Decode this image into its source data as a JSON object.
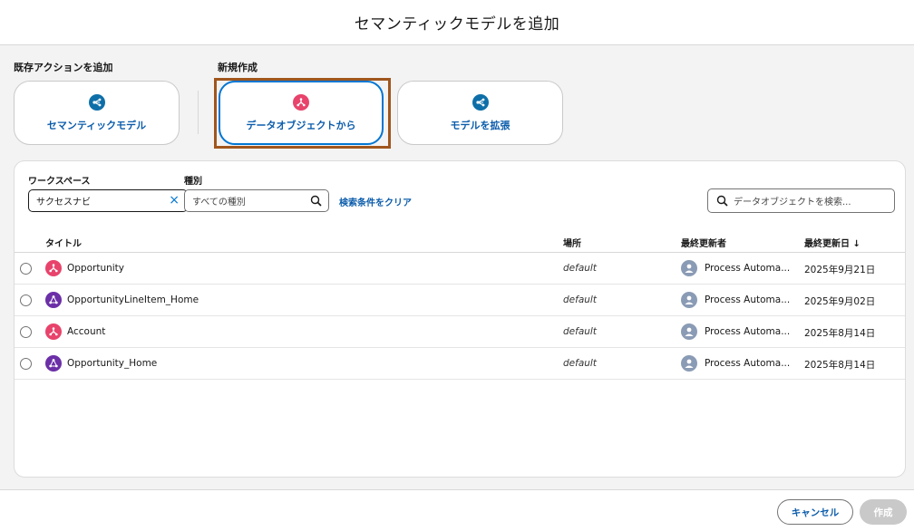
{
  "header": {
    "title": "セマンティックモデルを追加"
  },
  "sections": {
    "existing_label": "既存アクションを追加",
    "new_label": "新規作成"
  },
  "cards": [
    {
      "label": "セマンティックモデル",
      "icon": "semantic-model-icon",
      "color": "#0e6fa8"
    },
    {
      "label": "データオブジェクトから",
      "icon": "data-object-icon",
      "color": "#e8436b",
      "selected": true
    },
    {
      "label": "モデルを拡張",
      "icon": "extend-model-icon",
      "color": "#0e6fa8"
    }
  ],
  "filters": {
    "workspace_label": "ワークスペース",
    "workspace_value": "サクセスナビ",
    "type_label": "種別",
    "type_placeholder": "すべての種別",
    "clear_link": "検索条件をクリア",
    "search_placeholder": "データオブジェクトを検索..."
  },
  "table": {
    "columns": [
      "タイトル",
      "場所",
      "最終更新者",
      "最終更新日 ↓"
    ],
    "rows": [
      {
        "title": "Opportunity",
        "location": "default",
        "updater": "Process Automa...",
        "date": "2025年9月21日",
        "icon": "data-object-icon",
        "icon_color": "#e8436b"
      },
      {
        "title": "OpportunityLineItem_Home",
        "location": "default",
        "updater": "Process Automa...",
        "date": "2025年9月02日",
        "icon": "data-model-icon",
        "icon_color": "#6b2fa7"
      },
      {
        "title": "Account",
        "location": "default",
        "updater": "Process Automa...",
        "date": "2025年8月14日",
        "icon": "data-object-icon",
        "icon_color": "#e8436b"
      },
      {
        "title": "Opportunity_Home",
        "location": "default",
        "updater": "Process Automa...",
        "date": "2025年8月14日",
        "icon": "data-model-icon",
        "icon_color": "#6b2fa7"
      }
    ]
  },
  "footer": {
    "cancel_label": "キャンセル",
    "create_label": "作成"
  },
  "colors": {
    "accent": "#0176d3",
    "link": "#0b5cab",
    "highlight_frame": "#a0561d"
  }
}
